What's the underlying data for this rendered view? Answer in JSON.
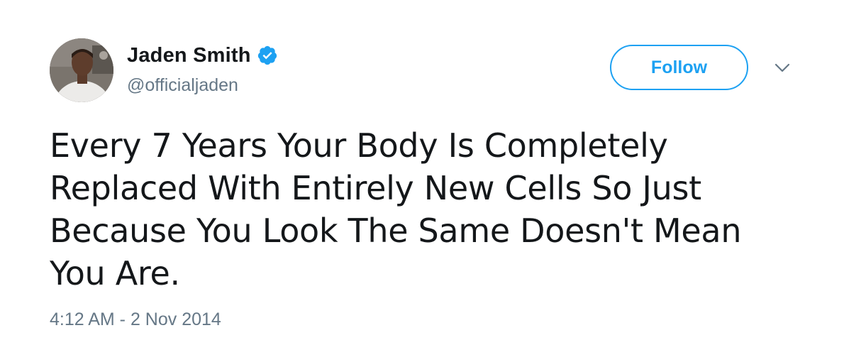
{
  "author": {
    "display_name": "Jaden Smith",
    "handle": "@officialjaden",
    "verified": true,
    "avatar_icon": "profile-photo"
  },
  "actions": {
    "follow_label": "Follow",
    "more_icon": "chevron-down-icon"
  },
  "tweet": {
    "text": "Every 7 Years Your Body Is Completely Replaced With Entirely New Cells So Just Because You Look The Same Doesn't Mean You Are.",
    "timestamp": "4:12 AM - 2 Nov 2014"
  },
  "colors": {
    "accent": "#1da1f2",
    "text_primary": "#14171a",
    "text_secondary": "#657786"
  }
}
